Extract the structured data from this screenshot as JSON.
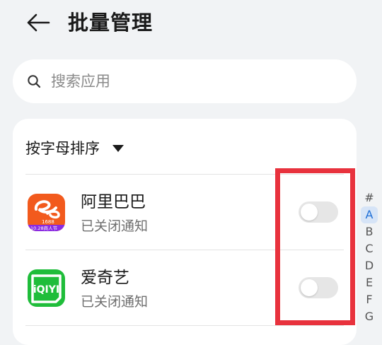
{
  "header": {
    "title": "批量管理"
  },
  "search": {
    "placeholder": "搜索应用"
  },
  "sort": {
    "label": "按字母排序"
  },
  "apps": [
    {
      "name": "阿里巴巴",
      "status": "已关闭通知",
      "notifications_enabled": false,
      "icon_text": "1688",
      "icon_badge": "10.28商人节"
    },
    {
      "name": "爱奇艺",
      "status": "已关闭通知",
      "notifications_enabled": false,
      "icon_text": "iQIYI"
    }
  ],
  "alpha_index": {
    "letters": [
      "#",
      "A",
      "B",
      "C",
      "D",
      "E",
      "F",
      "G"
    ],
    "active": "A"
  },
  "colors": {
    "background": "#f1f3f5",
    "highlight": "#e8323d",
    "alibaba_icon": "#f25a1d",
    "iqiyi_icon": "#1fbd3a",
    "index_active": "#1f6fd6"
  }
}
